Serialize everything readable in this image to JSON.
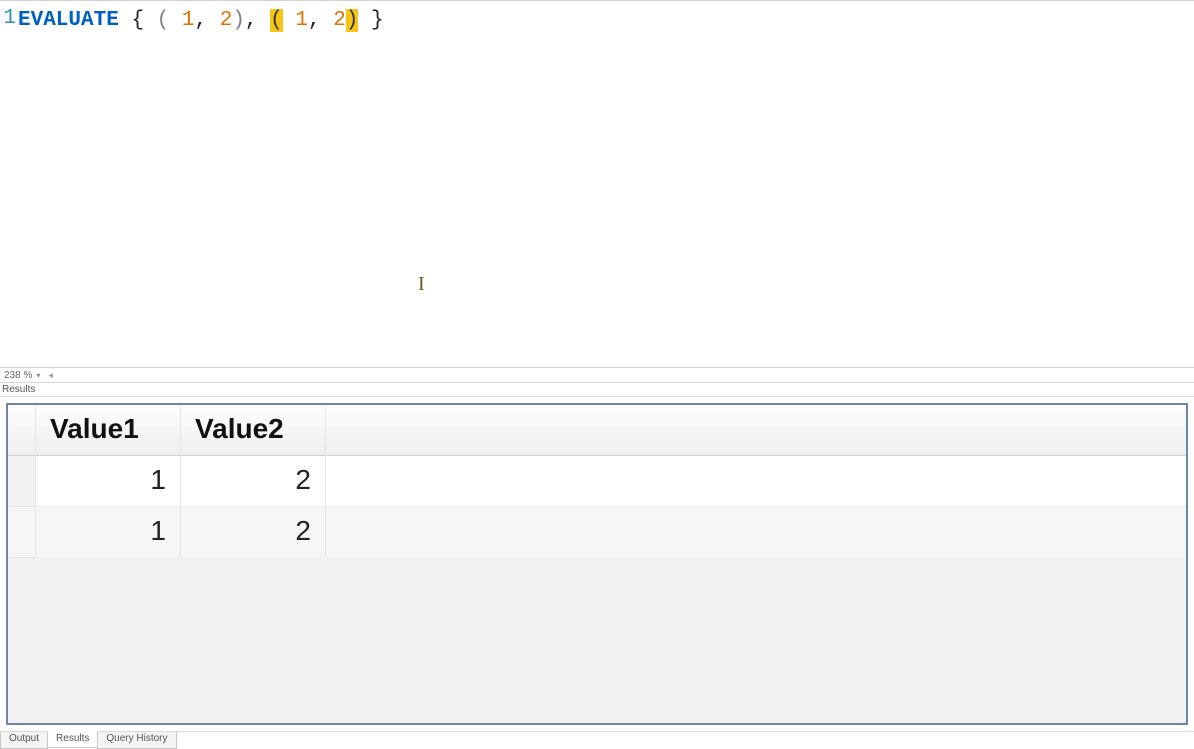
{
  "editor": {
    "line_number": "1",
    "tokens": {
      "evaluate": "EVALUATE",
      "space": " ",
      "lbrace": "{",
      "lparen": "(",
      "rparen": ")",
      "rbrace": "}",
      "comma": ",",
      "num1": "1",
      "num2": "2"
    },
    "zoom": "238 %"
  },
  "results": {
    "panel_label": "Results",
    "columns": [
      "Value1",
      "Value2"
    ],
    "rows": [
      {
        "v1": "1",
        "v2": "2"
      },
      {
        "v1": "1",
        "v2": "2"
      }
    ]
  },
  "tabs": {
    "output": "Output",
    "results": "Results",
    "history": "Query History"
  }
}
